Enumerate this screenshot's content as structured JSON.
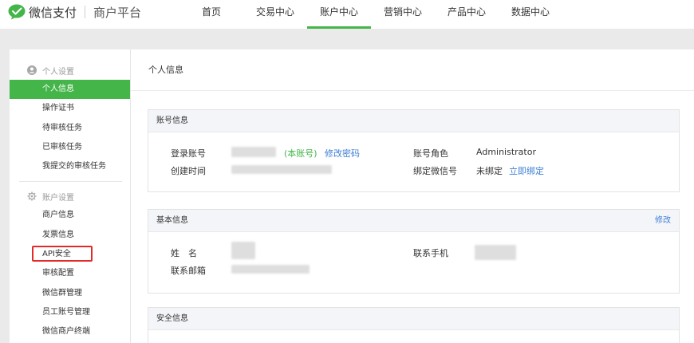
{
  "header": {
    "brand": "微信支付",
    "sub_brand": "商户平台",
    "nav": [
      {
        "label": "首页"
      },
      {
        "label": "交易中心"
      },
      {
        "label": "账户中心",
        "active": true
      },
      {
        "label": "营销中心"
      },
      {
        "label": "产品中心"
      },
      {
        "label": "数据中心"
      }
    ]
  },
  "sidebar": {
    "group1": {
      "title": "个人设置",
      "icon": "user-circle-icon",
      "items": [
        {
          "label": "个人信息",
          "active": true
        },
        {
          "label": "操作证书"
        },
        {
          "label": "待审核任务"
        },
        {
          "label": "已审核任务"
        },
        {
          "label": "我提交的审核任务"
        }
      ]
    },
    "group2": {
      "title": "账户设置",
      "icon": "gear-icon",
      "items": [
        {
          "label": "商户信息"
        },
        {
          "label": "发票信息"
        },
        {
          "label": "API安全"
        },
        {
          "label": "审核配置"
        },
        {
          "label": "微信群管理"
        },
        {
          "label": "员工账号管理"
        },
        {
          "label": "微信商户终端"
        }
      ]
    }
  },
  "main": {
    "title": "个人信息",
    "account": {
      "title": "账号信息",
      "login_label": "登录账号",
      "self_tag": "(本账号)",
      "change_password": "修改密码",
      "created_label": "创建时间",
      "role_label": "账号角色",
      "role_value": "Administrator",
      "wechat_label": "绑定微信号",
      "wechat_value": "未绑定",
      "bind_now": "立即绑定"
    },
    "basic": {
      "title": "基本信息",
      "edit": "修改",
      "name_label": "姓　名",
      "email_label": "联系邮箱",
      "phone_label": "联系手机"
    },
    "security": {
      "title": "安全信息"
    }
  },
  "colors": {
    "accent": "#44b549",
    "link": "#3d7fd4",
    "highlight": "#e32a2a"
  }
}
